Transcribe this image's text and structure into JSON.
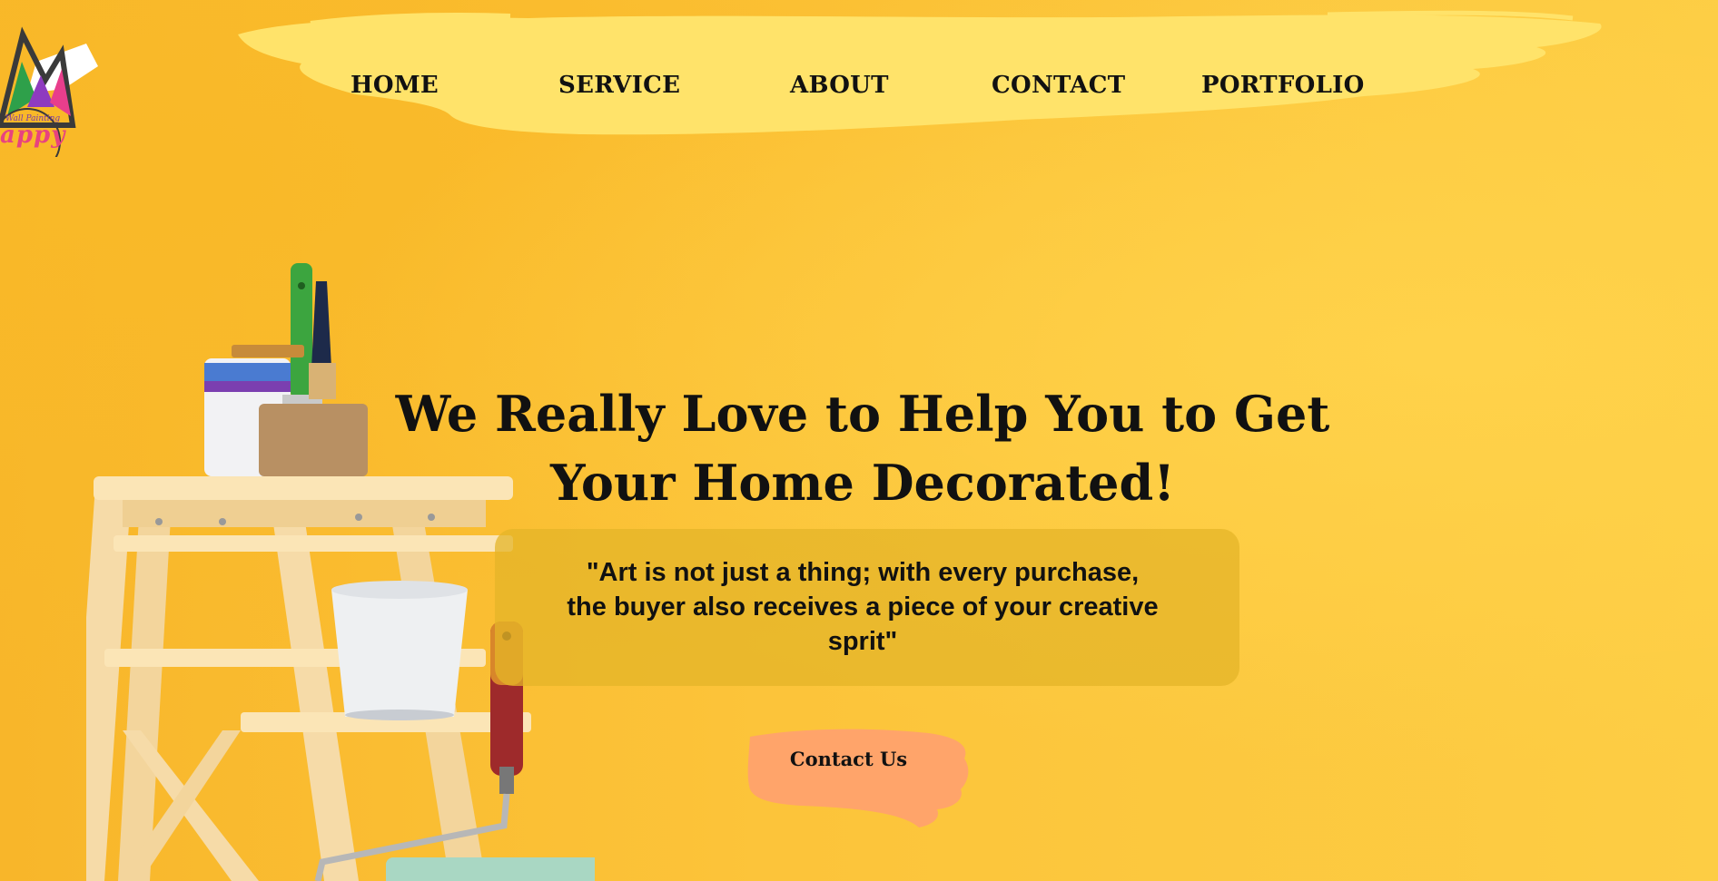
{
  "nav": {
    "items": [
      {
        "label": "HOME"
      },
      {
        "label": "SERVICE"
      },
      {
        "label": "ABOUT"
      },
      {
        "label": "CONTACT"
      },
      {
        "label": "PORTFOLIO"
      }
    ]
  },
  "logo": {
    "script_text": "Wall Painting",
    "word": "appy"
  },
  "hero": {
    "headline_line1": "We Really Love to Help You to Get",
    "headline_line2": "Your Home Decorated!",
    "quote_line1": "\"Art is not just a thing; with every purchase,",
    "quote_line2": "the buyer also receives a piece of your creative",
    "quote_line3": "sprit\"",
    "cta_label": "Contact Us"
  },
  "colors": {
    "background": "#fcc63a",
    "nav_brush": "#ffe36a",
    "quote_box": "#e8b62b",
    "cta_brush": "#ffa46a",
    "text": "#111111"
  }
}
